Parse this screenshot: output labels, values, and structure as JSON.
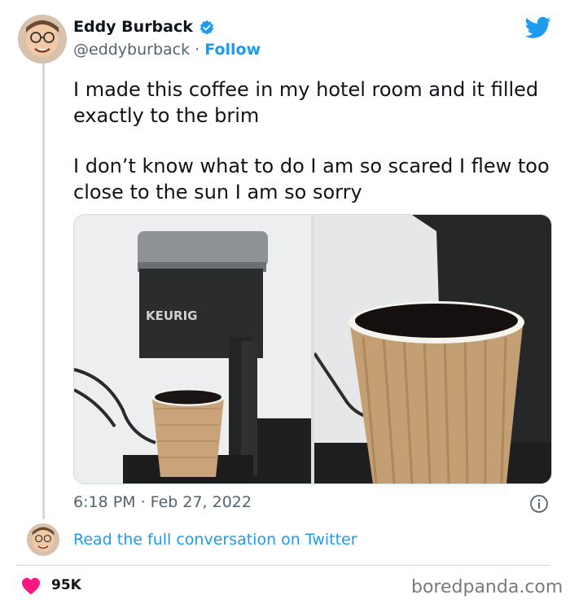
{
  "author": {
    "name": "Eddy Burback",
    "handle": "@eddyburback",
    "separator": " · ",
    "follow_label": "Follow"
  },
  "tweet": {
    "paragraphs": [
      "I made this coffee in my hotel room and it filled exactly to the brim",
      "I don’t know what to do I am so scared I flew too close to the sun I am so sorry"
    ],
    "photo_text": "KEURIG"
  },
  "meta": {
    "timestamp": "6:18 PM · Feb 27, 2022"
  },
  "conversation_link": "Read the full conversation on Twitter",
  "likes": {
    "count": "95K"
  },
  "watermark": "boredpanda.com",
  "icons": {
    "verified": "verified-badge-icon",
    "brand": "twitter-bird-icon",
    "info": "info-icon",
    "like": "heart-icon"
  },
  "colors": {
    "accent": "#1d9bf0",
    "text": "#0f1419",
    "secondary": "#536471",
    "heart": "#f91880",
    "divider": "#cfd9de"
  }
}
